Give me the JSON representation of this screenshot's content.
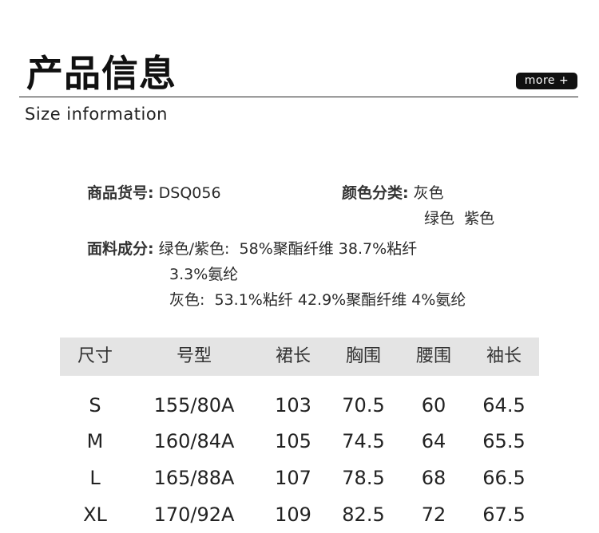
{
  "header": {
    "title": "产品信息",
    "subtitle": "Size information",
    "more_label": "more +"
  },
  "product": {
    "sku_label": "商品货号:",
    "sku_value": "DSQ056",
    "color_label": "颜色分类:",
    "color_line1": "灰色",
    "color_line2": "绿色  紫色",
    "material_label": "面料成分:",
    "material_line1": "绿色/紫色:  58%聚酯纤维 38.7%粘纤",
    "material_line2": "3.3%氨纶",
    "material_line3": "灰色:  53.1%粘纤 42.9%聚酯纤维 4%氨纶"
  },
  "size_table": {
    "headers": [
      "尺寸",
      "号型",
      "裙长",
      "胸围",
      "腰围",
      "袖长"
    ],
    "rows": [
      [
        "S",
        "155/80A",
        "103",
        "70.5",
        "60",
        "64.5"
      ],
      [
        "M",
        "160/84A",
        "105",
        "74.5",
        "64",
        "65.5"
      ],
      [
        "L",
        "165/88A",
        "107",
        "78.5",
        "68",
        "66.5"
      ],
      [
        "XL",
        "170/92A",
        "109",
        "82.5",
        "72",
        "67.5"
      ]
    ]
  }
}
